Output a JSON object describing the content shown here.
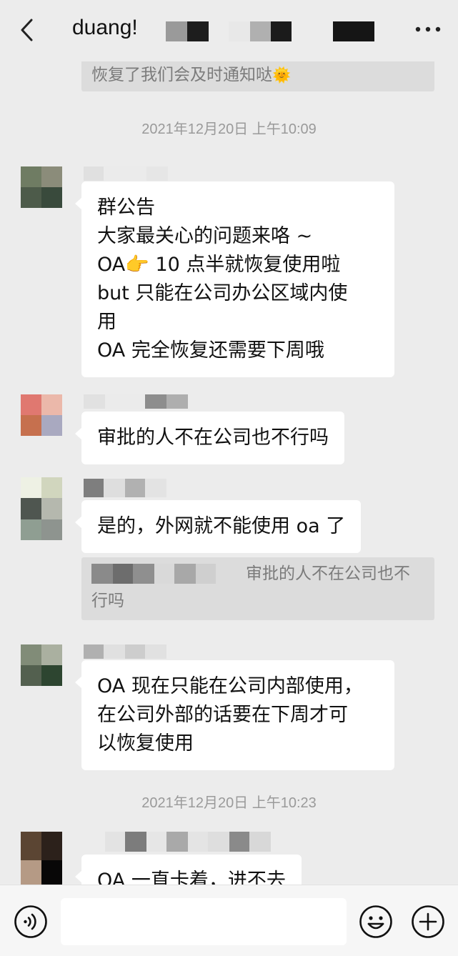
{
  "header": {
    "title": "duang!",
    "back_icon": "chevron-left-icon",
    "more_icon": "more-dots-icon"
  },
  "quote_top": {
    "text": "恢复了我们会及时通知哒",
    "emoji": "🌞"
  },
  "timestamps": [
    "2021年12月20日 上午10:09",
    "2021年12月20日 上午10:23"
  ],
  "messages": [
    {
      "lines": [
        "群公告",
        "大家最关心的问题来咯 ~",
        "OA👉 10 点半就恢复使用啦",
        "but 只能在公司办公区域内使",
        "用",
        "OA 完全恢复还需要下周哦"
      ],
      "avatar_colors": [
        "#6f7c63",
        "#8b8c7a",
        "#4d5b4a",
        "#394a3c"
      ],
      "name_blur": [
        "#e2e2e2",
        "#ececec",
        "#e6e6e6"
      ]
    },
    {
      "lines": [
        "审批的人不在公司也不行吗"
      ],
      "avatar_colors": [
        "#e07870",
        "#ebb8aa",
        "#c6704e",
        "#a9a9c0"
      ],
      "name_blur": [
        "#e1e1e1",
        "#ebebeb",
        "#8d8d8d",
        "#aeaeae"
      ]
    },
    {
      "lines": [
        "是的，外网就不能使用 oa 了"
      ],
      "avatar_colors": [
        "#eef1e4",
        "#d1d6be",
        "#4f5650",
        "#b5b8ae"
      ],
      "avatar_colors_b": [
        "#8f9e92",
        "#8e948f"
      ],
      "name_blur": [
        "#7e7e7e",
        "#dedede",
        "#b1b1b1",
        "#e3e3e3"
      ]
    },
    {
      "lines": [
        "OA 现在只能在公司内部使用，",
        "在公司外部的话要在下周才可",
        "以恢复使用"
      ],
      "avatar_colors": [
        "#818c78",
        "#aab0a0",
        "#53604f",
        "#2d4530"
      ],
      "name_blur": [
        "#b0b0b0",
        "#e0e0e0",
        "#cdcdcd",
        "#e1e1e1"
      ]
    },
    {
      "lines": [
        "OA 一直卡着，进不去"
      ],
      "avatar_colors": [
        "#5b4533",
        "#2c211b",
        "#b59a85",
        "#080707"
      ],
      "name_blur": [
        "#ececec",
        "#e3e3e3",
        "#7c7c7c",
        "#a9a9a9",
        "#dedede",
        "#8a8a8a",
        "#d8d8d8"
      ]
    }
  ],
  "reply_quote": {
    "text_line1": "审批的人不在公司也不",
    "text_line2": "行吗",
    "name_blur": [
      "#8a8a8a",
      "#6d6d6d",
      "#8f8f8f",
      "#d9d9d9",
      "#a8a8a8",
      "#cfcfcf"
    ]
  },
  "input_bar": {
    "voice_icon": "voice-icon",
    "emoji_icon": "emoji-icon",
    "plus_icon": "plus-icon",
    "placeholder": ""
  }
}
